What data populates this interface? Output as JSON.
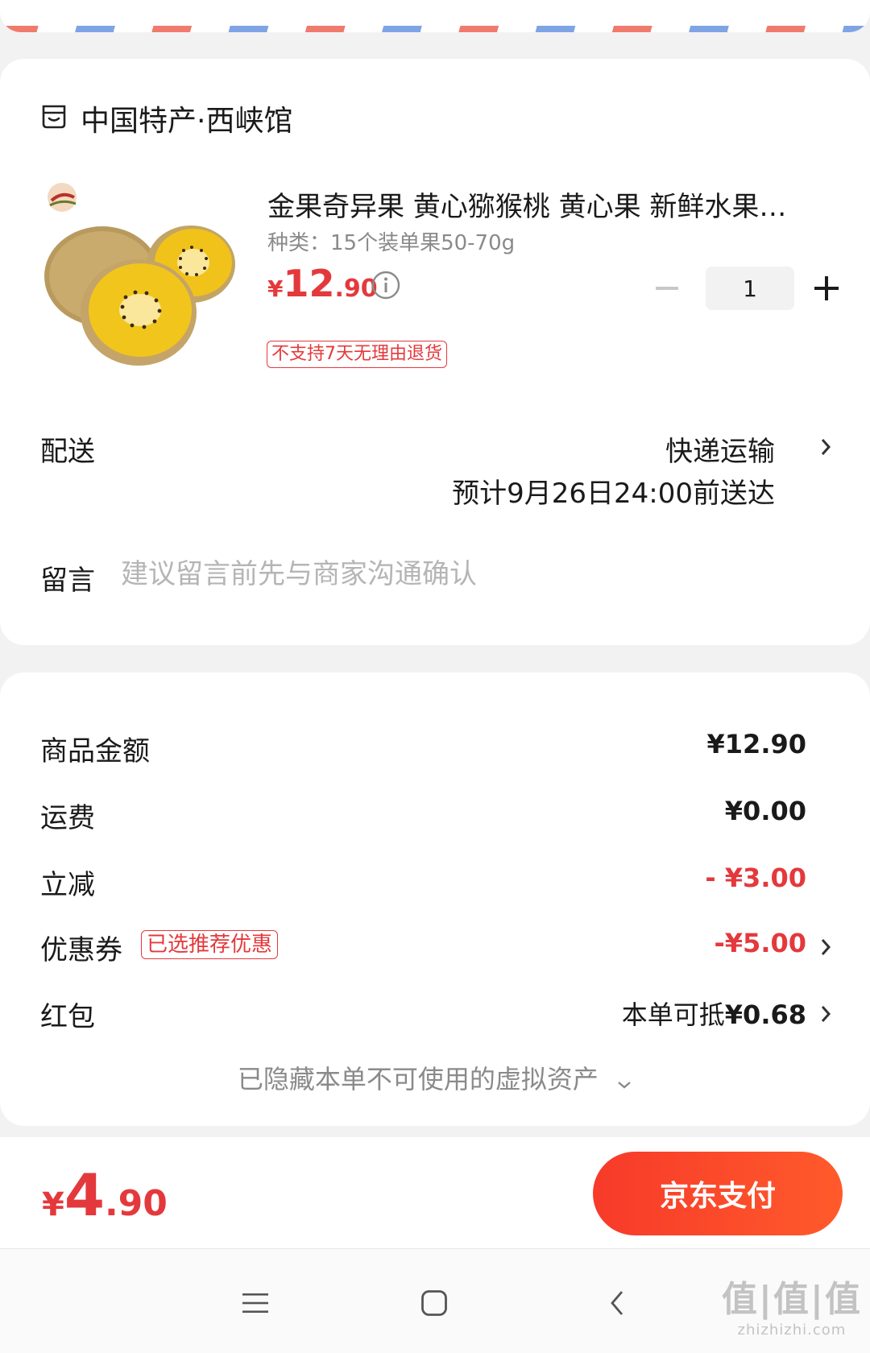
{
  "shop": {
    "name": "中国特产·西峡馆",
    "icon": "store-icon"
  },
  "product": {
    "title": "金果奇异果 黄心猕猴桃 黄心果 新鲜水果…",
    "spec": "种类：15个装单果50-70g",
    "price_currency": "¥",
    "price_int": "12",
    "price_dec": ".90",
    "quantity": "1",
    "badge": "不支持7天无理由退货",
    "image": "kiwi-fruit-image"
  },
  "delivery": {
    "label": "配送",
    "method": "快递运输",
    "eta": "预计9月26日24:00前送达"
  },
  "message": {
    "label": "留言",
    "placeholder": "建议留言前先与商家沟通确认"
  },
  "summary": {
    "goods_label": "商品金额",
    "goods_value": "¥12.90",
    "shipping_label": "运费",
    "shipping_value": "¥0.00",
    "discount_label": "立减",
    "discount_value": "- ¥3.00",
    "coupon_label": "优惠券",
    "coupon_badge": "已选推荐优惠",
    "coupon_value": "-¥5.00",
    "redpack_label": "红包",
    "redpack_prefix": "本单可抵",
    "redpack_value": "¥0.68",
    "hidden_assets": "已隐藏本单不可使用的虚拟资产"
  },
  "checkout": {
    "total_currency": "¥",
    "total_int": "4",
    "total_dec": ".90",
    "pay_label": "京东支付"
  },
  "watermark": {
    "main": "值|值|值",
    "sub": "zhizhizhi.com"
  },
  "colors": {
    "accent_red": "#e4393c",
    "pay_gradient_start": "#f73a2a",
    "pay_gradient_end": "#ff5a2b"
  }
}
